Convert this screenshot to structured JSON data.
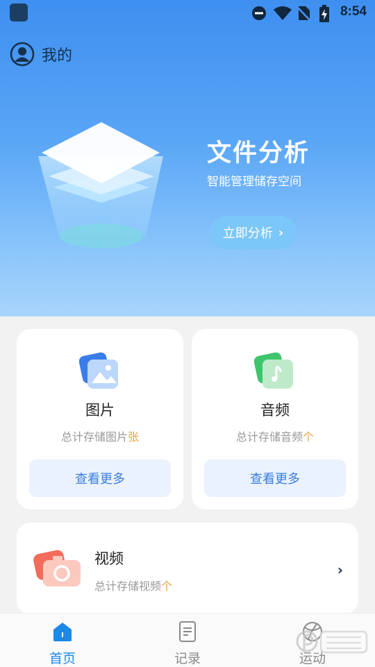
{
  "status_bar": {
    "time": "8:54"
  },
  "header": {
    "title": "我的"
  },
  "hero": {
    "title": "文件分析",
    "subtitle": "智能管理储存空间",
    "button_label": "立即分析"
  },
  "cards": [
    {
      "title": "图片",
      "subtitle_prefix": "总计存储图片",
      "unit": "张",
      "button_label": "查看更多"
    },
    {
      "title": "音频",
      "subtitle_prefix": "总计存储音频",
      "unit": "个",
      "button_label": "查看更多"
    }
  ],
  "video_card": {
    "title": "视频",
    "subtitle_prefix": "总计存储视频",
    "unit": "个"
  },
  "tabs": [
    {
      "label": "首页",
      "active": true
    },
    {
      "label": "记录",
      "active": false
    },
    {
      "label": "运动",
      "active": false
    }
  ],
  "colors": {
    "accent": "#1e88e5",
    "unit": "#e8a33b",
    "button_text": "#3b7de0"
  }
}
